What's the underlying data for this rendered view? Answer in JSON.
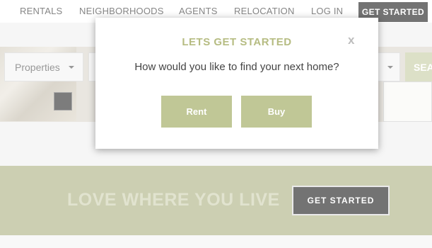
{
  "nav": {
    "items": [
      "RENTALS",
      "NEIGHBORHOODS",
      "AGENTS",
      "RELOCATION",
      "LOG IN"
    ],
    "cta_label": "GET STARTED"
  },
  "search": {
    "property_type_label": "Properties",
    "search_button_label": "SEA"
  },
  "banner": {
    "title": "LOVE WHERE YOU LIVE",
    "cta_label": "GET STARTED"
  },
  "modal": {
    "title": "LETS GET STARTED",
    "close_label": "x",
    "question": "How would you like to find your next home?",
    "options": [
      "Rent",
      "Buy"
    ]
  },
  "colors": {
    "accent": "#c0c796",
    "banner": "#a3a873",
    "title_accent": "#b6bc82"
  }
}
